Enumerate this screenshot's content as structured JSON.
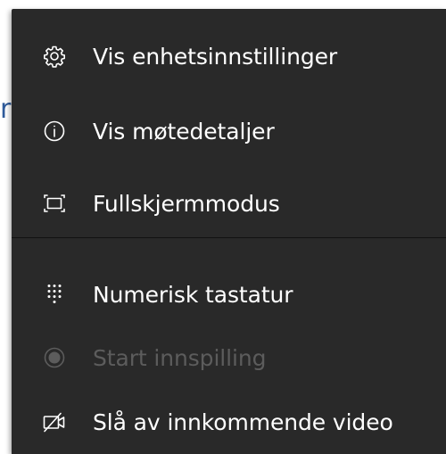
{
  "background": {
    "fragment_text": "r"
  },
  "menu": {
    "items": [
      {
        "label": "Vis enhetsinnstillinger",
        "icon": "gear-icon"
      },
      {
        "label": "Vis møtedetaljer",
        "icon": "info-icon"
      },
      {
        "label": "Fullskjermmodus",
        "icon": "fullscreen-icon"
      },
      {
        "label": "Numerisk tastatur",
        "icon": "dialpad-icon"
      },
      {
        "label": "Start innspilling",
        "icon": "record-icon",
        "disabled": true
      },
      {
        "label": "Slå av innkommende video",
        "icon": "video-off-icon"
      }
    ],
    "colors": {
      "menu_bg": "#292929",
      "text": "#ffffff",
      "disabled_text": "#5c5c5c",
      "divider": "#111111",
      "background_link": "#2f5b9a"
    }
  }
}
